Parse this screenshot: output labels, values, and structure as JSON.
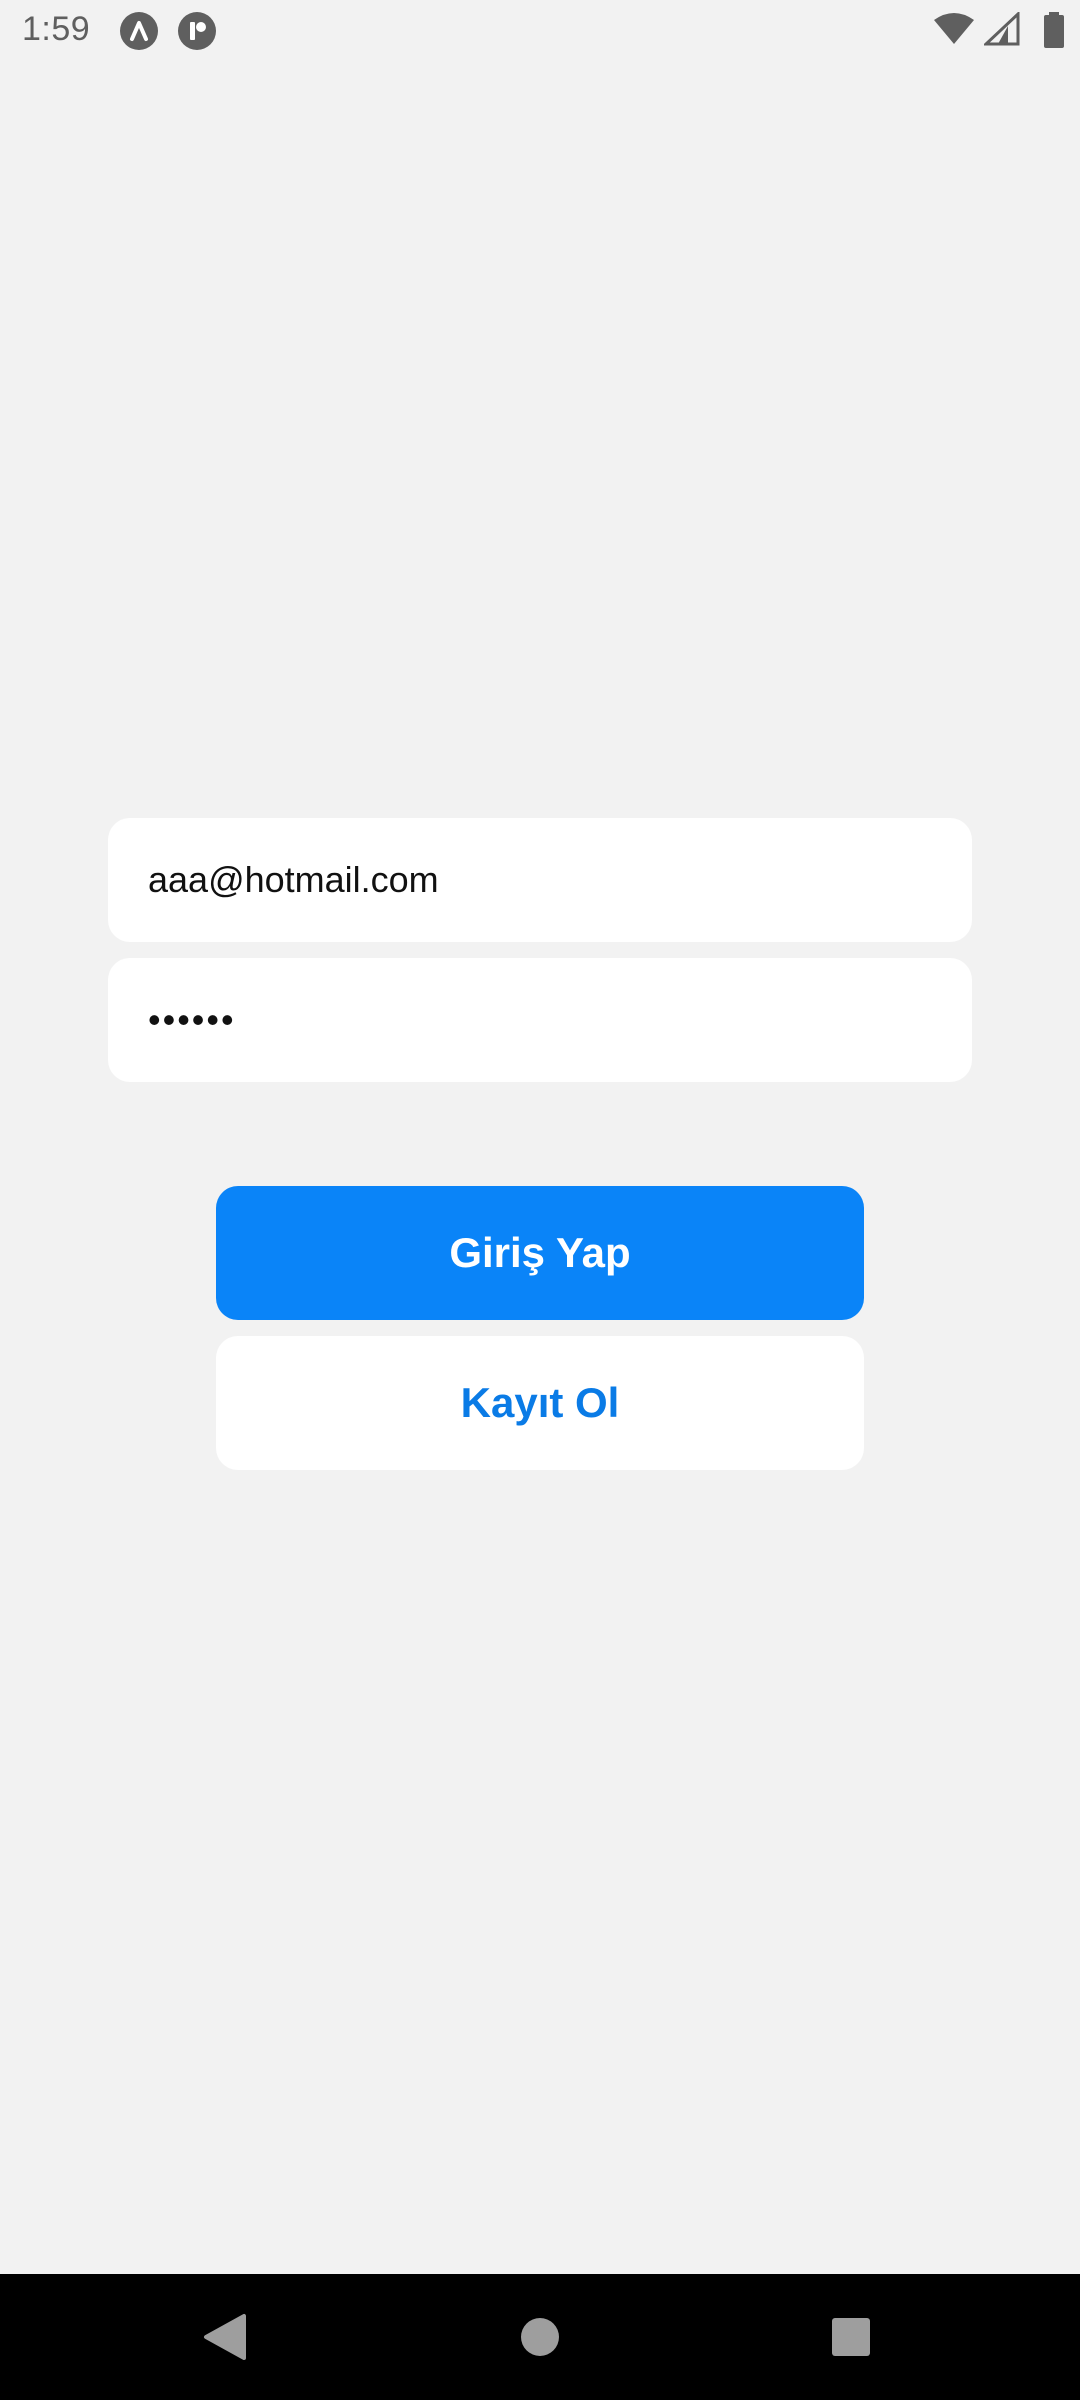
{
  "status_bar": {
    "time": "1:59",
    "icons": [
      "app-a-icon",
      "app-r-icon",
      "wifi-icon",
      "signal-icon",
      "battery-icon"
    ],
    "icon_color": "#5f5f5f"
  },
  "login_form": {
    "email_value": "aaa@hotmail.com",
    "password_value": "••••••",
    "login_button_label": "Giriş Yap",
    "register_button_label": "Kayıt Ol"
  },
  "colors": {
    "background": "#f2f2f2",
    "primary": "#0a84f8",
    "primary_text": "#0a7be6",
    "field_background": "#ffffff",
    "nav_bar": "#000000"
  },
  "nav_bar": {
    "buttons": [
      "back-icon",
      "home-icon",
      "recent-apps-icon"
    ]
  }
}
